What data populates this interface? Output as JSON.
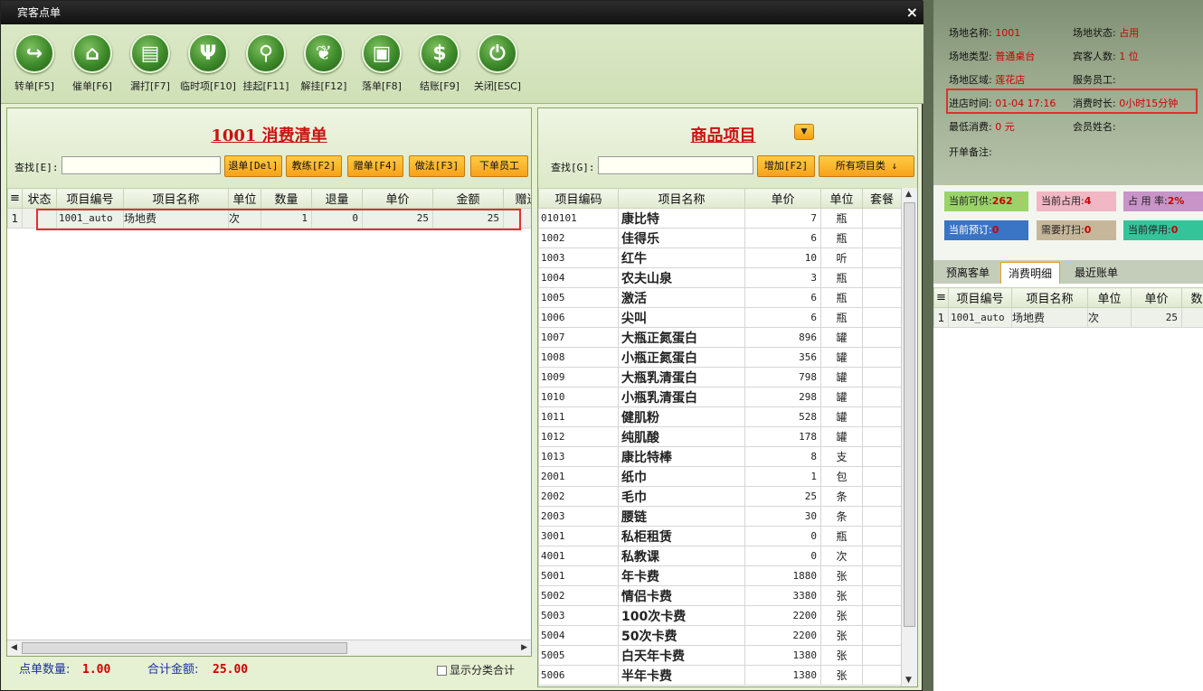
{
  "window": {
    "title": "宾客点单",
    "close": "×"
  },
  "toolbar": [
    {
      "label": "转单[F5]",
      "icon": "↪"
    },
    {
      "label": "催单[F6]",
      "icon": "⌂"
    },
    {
      "label": "漏打[F7]",
      "icon": "▤"
    },
    {
      "label": "临时项[F10]",
      "icon": "Ψ"
    },
    {
      "label": "挂起[F11]",
      "icon": "⚲"
    },
    {
      "label": "解挂[F12]",
      "icon": "❦"
    },
    {
      "label": "落单[F8]",
      "icon": "▣"
    },
    {
      "label": "结账[F9]",
      "icon": "$"
    },
    {
      "label": "关闭[ESC]",
      "icon": "⏻"
    }
  ],
  "left_panel": {
    "title": "1001 消费清单",
    "search_label": "查找[E]:",
    "search_value": "",
    "buttons": [
      "退单[Del]",
      "教练[F2]",
      "赠单[F4]",
      "做法[F3]",
      "下单员工"
    ],
    "columns": [
      "≡",
      "状态",
      "项目编号",
      "项目名称",
      "单位",
      "数量",
      "退量",
      "单价",
      "金额",
      "赠送"
    ],
    "rows": [
      {
        "idx": "1",
        "status": "",
        "code": "1001_auto",
        "name": "场地费",
        "unit": "次",
        "qty": "1",
        "ret": "0",
        "price": "25",
        "amount": "25"
      }
    ],
    "footer": {
      "count_label": "点单数量:",
      "count": "1.00",
      "total_label": "合计金额:",
      "total": "25.00",
      "checkbox_label": "显示分类合计"
    }
  },
  "right_panel": {
    "title": "商品项目",
    "search_label": "查找[G]:",
    "search_value": "",
    "add_button": "增加[F2]",
    "category_button": "所有项目类 ↓",
    "columns": [
      "项目编码",
      "项目名称",
      "单价",
      "单位",
      "套餐"
    ],
    "rows": [
      [
        "010101",
        "康比特",
        "7",
        "瓶"
      ],
      [
        "1002",
        "佳得乐",
        "6",
        "瓶"
      ],
      [
        "1003",
        "红牛",
        "10",
        "听"
      ],
      [
        "1004",
        "农夫山泉",
        "3",
        "瓶"
      ],
      [
        "1005",
        "激活",
        "6",
        "瓶"
      ],
      [
        "1006",
        "尖叫",
        "6",
        "瓶"
      ],
      [
        "1007",
        "大瓶正氮蛋白",
        "896",
        "罐"
      ],
      [
        "1008",
        "小瓶正氮蛋白",
        "356",
        "罐"
      ],
      [
        "1009",
        "大瓶乳清蛋白",
        "798",
        "罐"
      ],
      [
        "1010",
        "小瓶乳清蛋白",
        "298",
        "罐"
      ],
      [
        "1011",
        "健肌粉",
        "528",
        "罐"
      ],
      [
        "1012",
        "纯肌酸",
        "178",
        "罐"
      ],
      [
        "1013",
        "康比特棒",
        "8",
        "支"
      ],
      [
        "2001",
        "纸巾",
        "1",
        "包"
      ],
      [
        "2002",
        "毛巾",
        "25",
        "条"
      ],
      [
        "2003",
        "腰链",
        "30",
        "条"
      ],
      [
        "3001",
        "私柜租赁",
        "0",
        "瓶"
      ],
      [
        "4001",
        "私教课",
        "0",
        "次"
      ],
      [
        "5001",
        "年卡费",
        "1880",
        "张"
      ],
      [
        "5002",
        "情侣卡费",
        "3380",
        "张"
      ],
      [
        "5003",
        "100次卡费",
        "2200",
        "张"
      ],
      [
        "5004",
        "50次卡费",
        "2200",
        "张"
      ],
      [
        "5005",
        "白天年卡费",
        "1380",
        "张"
      ],
      [
        "5006",
        "半年卡费",
        "1380",
        "张"
      ]
    ]
  },
  "venue": {
    "name_label": "场地名称:",
    "name": "1001",
    "status_label": "场地状态:",
    "status": "占用",
    "type_label": "场地类型:",
    "type": "普通桌台",
    "guests_label": "宾客人数:",
    "guests": "1 位",
    "area_label": "场地区域:",
    "area": "莲花店",
    "staff_label": "服务员工:",
    "staff": "",
    "checkin_label": "进店时间:",
    "checkin": "01-04 17:16",
    "duration_label": "消费时长:",
    "duration": "0小时15分钟",
    "min_label": "最低消费:",
    "min": "0 元",
    "member_label": "会员姓名:",
    "member": "",
    "note_label": "开单备注:",
    "note": ""
  },
  "stats": {
    "available_label": "当前可供:",
    "available": "262",
    "occupied_label": "当前占用:",
    "occupied": "4",
    "rate_label": "占 用 率:",
    "rate": "2%",
    "reserved_label": "当前预订:",
    "reserved": "0",
    "clean_label": "需要打扫:",
    "clean": "0",
    "disabled_label": "当前停用:",
    "disabled": "0"
  },
  "side_tabs": [
    "预离客单",
    "消费明细",
    "最近账单"
  ],
  "side_table": {
    "columns": [
      "≡",
      "项目编号",
      "项目名称",
      "单位",
      "单价",
      "数量"
    ],
    "rows": [
      {
        "idx": "1",
        "code": "1001_auto",
        "name": "场地费",
        "unit": "次",
        "price": "25",
        "qty": ""
      }
    ]
  },
  "colors": {
    "accent_red": "#cc1111",
    "button_orange": "#f7a11a",
    "green": "#3d8a2a"
  }
}
